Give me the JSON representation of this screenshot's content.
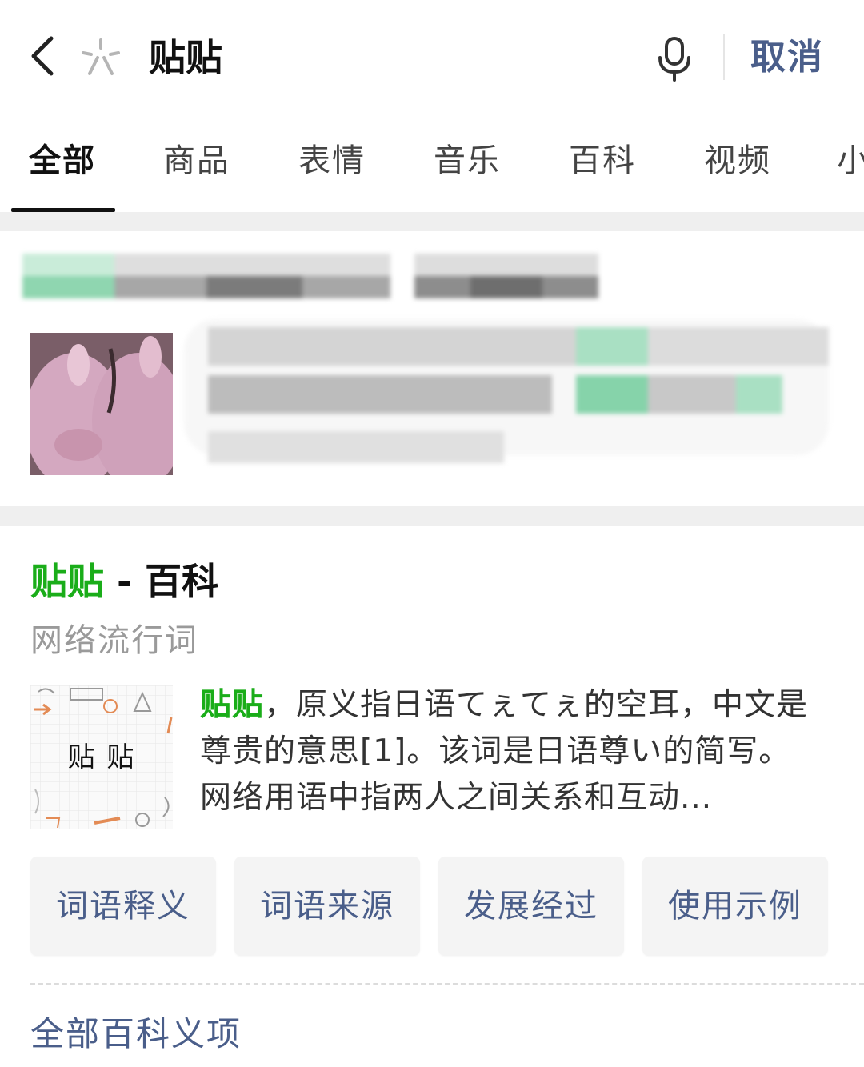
{
  "search": {
    "query": "贴贴",
    "cancel_label": "取消"
  },
  "tabs": [
    {
      "label": "全部",
      "active": true
    },
    {
      "label": "商品"
    },
    {
      "label": "表情"
    },
    {
      "label": "音乐"
    },
    {
      "label": "百科"
    },
    {
      "label": "视频"
    },
    {
      "label": "小"
    }
  ],
  "baike": {
    "title_keyword": "贴贴",
    "title_suffix": " - 百科",
    "subtitle": "网络流行词",
    "thumb_label": "贴 贴",
    "desc_keyword": "贴贴",
    "desc_text": "，原义指日语てぇてぇ的空耳，中文是尊贵的意思[1]。该词是日语尊い的简写。 网络用语中指两人之间关系和互动...",
    "chips": [
      "词语释义",
      "词语来源",
      "发展经过",
      "使用示例"
    ],
    "all_items_label": "全部百科义项"
  },
  "colors": {
    "accent_green": "#1aad19",
    "link_blue": "#4a5e8a"
  }
}
